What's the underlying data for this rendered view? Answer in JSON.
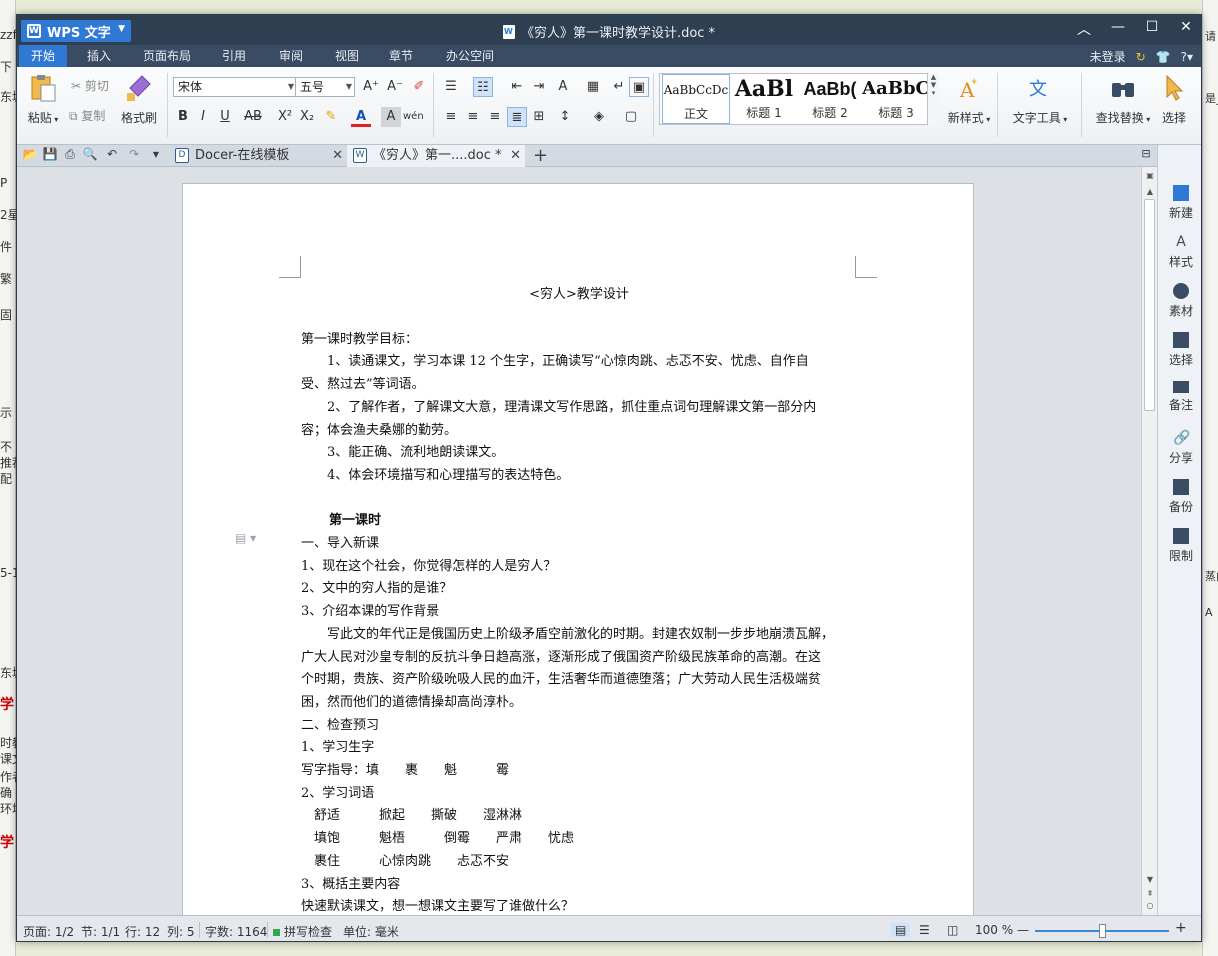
{
  "background_app": {
    "left_fragments": [
      "zzf",
      "下",
      "东城",
      "P",
      "2星",
      "件",
      "繁",
      "固",
      "示",
      "不",
      "推荐",
      "配",
      "5-1",
      "东城",
      "学",
      "时教",
      "课文",
      "作者",
      "确",
      "环境",
      "学"
    ],
    "right_fragments": [
      "请",
      "是_日",
      "蒸内",
      "A"
    ]
  },
  "titlebar": {
    "app_name": "WPS 文字",
    "document_title": "《穷人》第一课时教学设计.doc *",
    "controls": [
      "︿",
      "—",
      "☐",
      "✕"
    ]
  },
  "menu": {
    "tabs": [
      "开始",
      "插入",
      "页面布局",
      "引用",
      "审阅",
      "视图",
      "章节",
      "办公空间"
    ],
    "active": "开始",
    "login": "未登录"
  },
  "ribbon": {
    "paste": "粘贴",
    "cut": "剪切",
    "copy": "复制",
    "format_painter": "格式刷",
    "font_name": "宋体",
    "font_size": "五号",
    "styles": [
      {
        "preview": "AaBbCcDc",
        "label": "正文"
      },
      {
        "preview": "AaBl",
        "label": "标题 1"
      },
      {
        "preview": "AaBb(",
        "label": "标题 2"
      },
      {
        "preview": "AaBbC",
        "label": "标题 3"
      }
    ],
    "new_style": "新样式",
    "text_tools": "文字工具",
    "find_replace": "查找替换",
    "select": "选择"
  },
  "tabs": {
    "docer": "Docer-在线模板",
    "doc": "《穷人》第一....doc *"
  },
  "document": {
    "title": "<穷人>教学设计",
    "lines": [
      "第一课时教学目标：",
      "　　1、读通课文，学习本课 12 个生字，正确读写“心惊肉跳、忐忑不安、忧虑、自作自",
      "受、熬过去”等词语。",
      "　　2、了解作者，了解课文大意，理清课文写作思路，抓住重点词句理解课文第一部分内",
      "容；体会渔夫桑娜的勤劳。",
      "　　3、能正确、流利地朗读课文。",
      "　　4、体会环境描写和心理描写的表达特色。"
    ],
    "section_title": "第一课时",
    "lines2": [
      "一、导入新课",
      "1、现在这个社会，你觉得怎样的人是穷人？",
      "2、文中的穷人指的是谁？",
      "3、介绍本课的写作背景",
      "　　写此文的年代正是俄国历史上阶级矛盾空前激化的时期。封建农奴制一步步地崩溃瓦解，",
      "广大人民对沙皇专制的反抗斗争日趋高涨，逐渐形成了俄国资产阶级民族革命的高潮。在这",
      "个时期，贵族、资产阶级吮吸人民的血汗，生活奢华而道德堕落；广大劳动人民生活极端贫",
      "困，然而他们的道德情操却高尚淳朴。",
      "二、检查预习",
      "1、学习生字",
      "写字指导：填　　裹　　魁　　　霉",
      "2、学习词语",
      "　舒适　　　掀起　　撕破　　湿淋淋",
      "　填饱　　　魁梧　　　倒霉　　严肃　　忧虑",
      "　裹住　　　心惊肉跳　　忐忑不安",
      "3、概括主要内容",
      "快速默读课文，想一想课文主要写了谁做什么？"
    ]
  },
  "taskpane": {
    "items": [
      "新建",
      "样式",
      "素材",
      "选择",
      "备注",
      "分享",
      "备份",
      "限制"
    ]
  },
  "status": {
    "page": "页面: 1/2",
    "section": "节: 1/1",
    "row": "行: 12",
    "col": "列: 5",
    "words": "字数: 1164",
    "spell": "拼写检查",
    "unit": "单位: 毫米",
    "zoom": "100 %",
    "zoom_fraction": 0.5
  },
  "colors": {
    "titlebar": "#2f3f52",
    "accent": "#2f78d4",
    "spell_ok": "#2fa84a"
  }
}
